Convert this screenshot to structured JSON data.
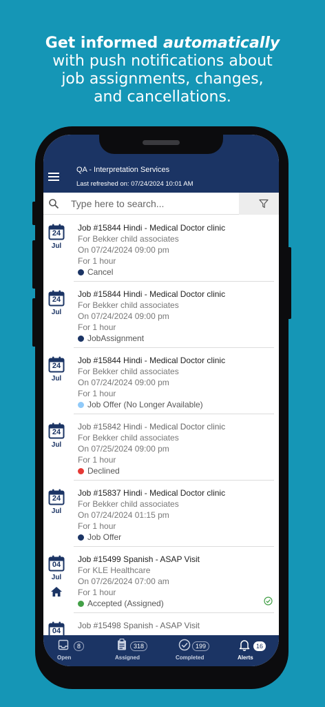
{
  "headline": {
    "bold_part": "Get informed ",
    "italic_part": "automatically",
    "line2": "with push notifications about",
    "line3": "job assignments, changes,",
    "line4": "and cancellations."
  },
  "header": {
    "org": "QA - Interpretation Services",
    "refreshed": "Last refreshed on: 07/24/2024 10:01 AM"
  },
  "search": {
    "placeholder": "Type here to search..."
  },
  "colors": {
    "navy": "#1b3464",
    "cancel": "#1b3464",
    "declined": "#e53935",
    "offer_na": "#90caf9",
    "accepted": "#43a047",
    "background": "#1596b6"
  },
  "items": [
    {
      "day": "24",
      "month": "Jul",
      "title": "Job #15844 Hindi - Medical Doctor clinic",
      "client": "For Bekker child associates",
      "date": "On 07/24/2024 09:00 pm",
      "duration": "For 1 hour",
      "status": "Cancel"
    },
    {
      "day": "24",
      "month": "Jul",
      "title": "Job #15844 Hindi - Medical Doctor clinic",
      "client": "For Bekker child associates",
      "date": "On 07/24/2024 09:00 pm",
      "duration": "For 1 hour",
      "status": "JobAssignment"
    },
    {
      "day": "24",
      "month": "Jul",
      "title": "Job #15844 Hindi - Medical Doctor clinic",
      "client": "For Bekker child associates",
      "date": "On 07/24/2024 09:00 pm",
      "duration": "For 1 hour",
      "status": "Job Offer (No Longer Available)"
    },
    {
      "day": "24",
      "month": "Jul",
      "title": "Job #15842 Hindi - Medical Doctor clinic",
      "client": "For Bekker child associates",
      "date": "On 07/25/2024 09:00 pm",
      "duration": "For 1 hour",
      "status": "Declined"
    },
    {
      "day": "24",
      "month": "Jul",
      "title": "Job #15837 Hindi - Medical Doctor clinic",
      "client": "For Bekker child associates",
      "date": "On 07/24/2024 01:15 pm",
      "duration": "For 1 hour",
      "status": "Job Offer"
    },
    {
      "day": "04",
      "month": "Jul",
      "title": "Job #15499 Spanish - ASAP Visit",
      "client": "For KLE Healthcare",
      "date": "On 07/26/2024 07:00 am",
      "duration": "For 1 hour",
      "status": "Accepted (Assigned)"
    },
    {
      "day": "04",
      "month": "",
      "title": "Job #15498 Spanish - ASAP Visit"
    }
  ],
  "tabs": [
    {
      "label": "Open",
      "count": "8"
    },
    {
      "label": "Assigned",
      "count": "318"
    },
    {
      "label": "Completed",
      "count": "199"
    },
    {
      "label": "Alerts",
      "count": "16"
    }
  ]
}
